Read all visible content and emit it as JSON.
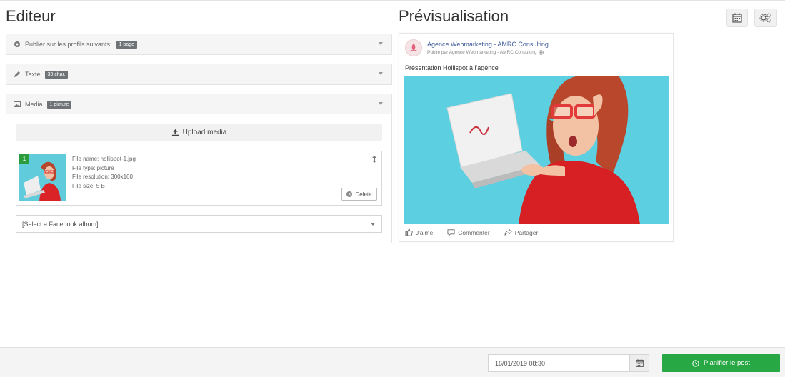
{
  "editor": {
    "title": "Editeur",
    "panels": [
      {
        "label": "Publier sur les profils suivants:",
        "badge": "1 page",
        "icon": "circle-icon"
      },
      {
        "label": "Texte",
        "badge": "33 char.",
        "icon": "pencil-icon"
      },
      {
        "label": "Media",
        "badge": "1 picture",
        "icon": "image-icon"
      }
    ],
    "media": {
      "upload_label": "Upload media",
      "item": {
        "index": "1",
        "file_name": "File name: hollispot-1.jpg",
        "file_type": "File type: picture",
        "file_resolution": "File resolution: 300x160",
        "file_size": "File size: 5 B",
        "delete_label": "Delete"
      },
      "album_select": "[Select a Facebook album]"
    }
  },
  "preview": {
    "title": "Prévisualisation",
    "page_name": "Agence Webmarketing - AMRC Consulting",
    "published_by": "Publié par Agence Webmarketing - AMRC Consulting",
    "text": "Présentation Hollispot à l'agence",
    "actions": [
      "J'aime",
      "Commenter",
      "Partager"
    ]
  },
  "footer": {
    "date_value": "16/01/2019 08:30",
    "plan_label": "Planifier le post"
  },
  "colors": {
    "accent_green": "#28a745",
    "badge_grey": "#6f7377",
    "link_blue": "#3b5998"
  }
}
